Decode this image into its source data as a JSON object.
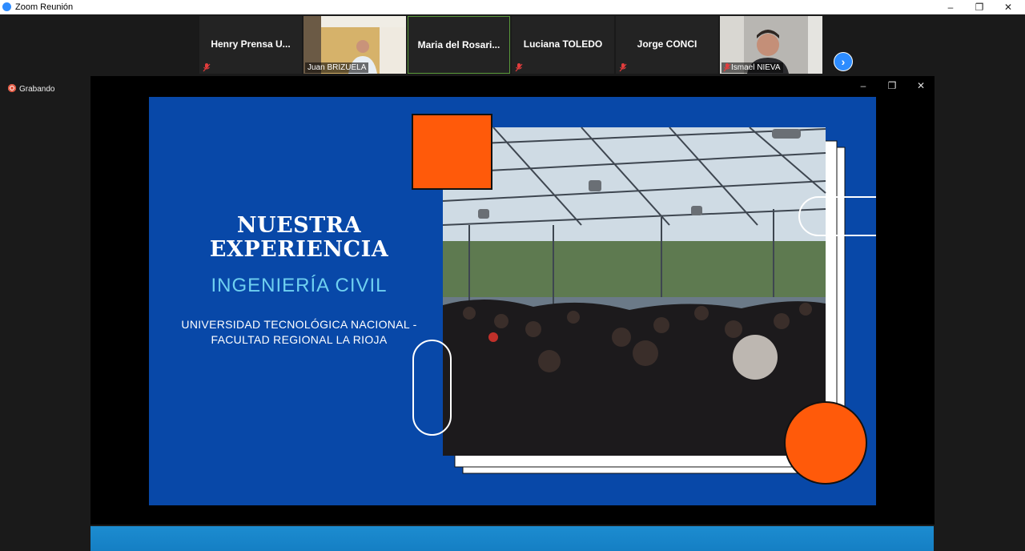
{
  "window": {
    "title": "Zoom Reunión",
    "minimize": "–",
    "restore": "❐",
    "close": "✕"
  },
  "participants": [
    {
      "name": "Henry Prensa U...",
      "video": false,
      "muted": true
    },
    {
      "name": "Juan BRIZUELA",
      "video": true,
      "muted": false
    },
    {
      "name": "Maria del Rosari...",
      "video": false,
      "muted": false,
      "active": true
    },
    {
      "name": "Luciana TOLEDO",
      "video": false,
      "muted": true
    },
    {
      "name": "Jorge CONCI",
      "video": false,
      "muted": true
    },
    {
      "name": "Ismael NIEVA",
      "video": true,
      "muted": true
    }
  ],
  "next_button": "›",
  "recording": {
    "label": "Grabando",
    "color": "#e2533b"
  },
  "share_controls": {
    "minimize": "–",
    "restore": "❐",
    "close": "✕"
  },
  "slide": {
    "title_line1": "NUESTRA",
    "title_line2": "EXPERIENCIA",
    "subtitle": "INGENIERÍA CIVIL",
    "institution_line1": "UNIVERSIDAD TECNOLÓGICA NACIONAL -",
    "institution_line2": "FACULTAD REGIONAL LA RIOJA",
    "colors": {
      "background": "#0848a8",
      "accent": "#ff5a0a",
      "subtitle": "#6fd0f0"
    }
  }
}
